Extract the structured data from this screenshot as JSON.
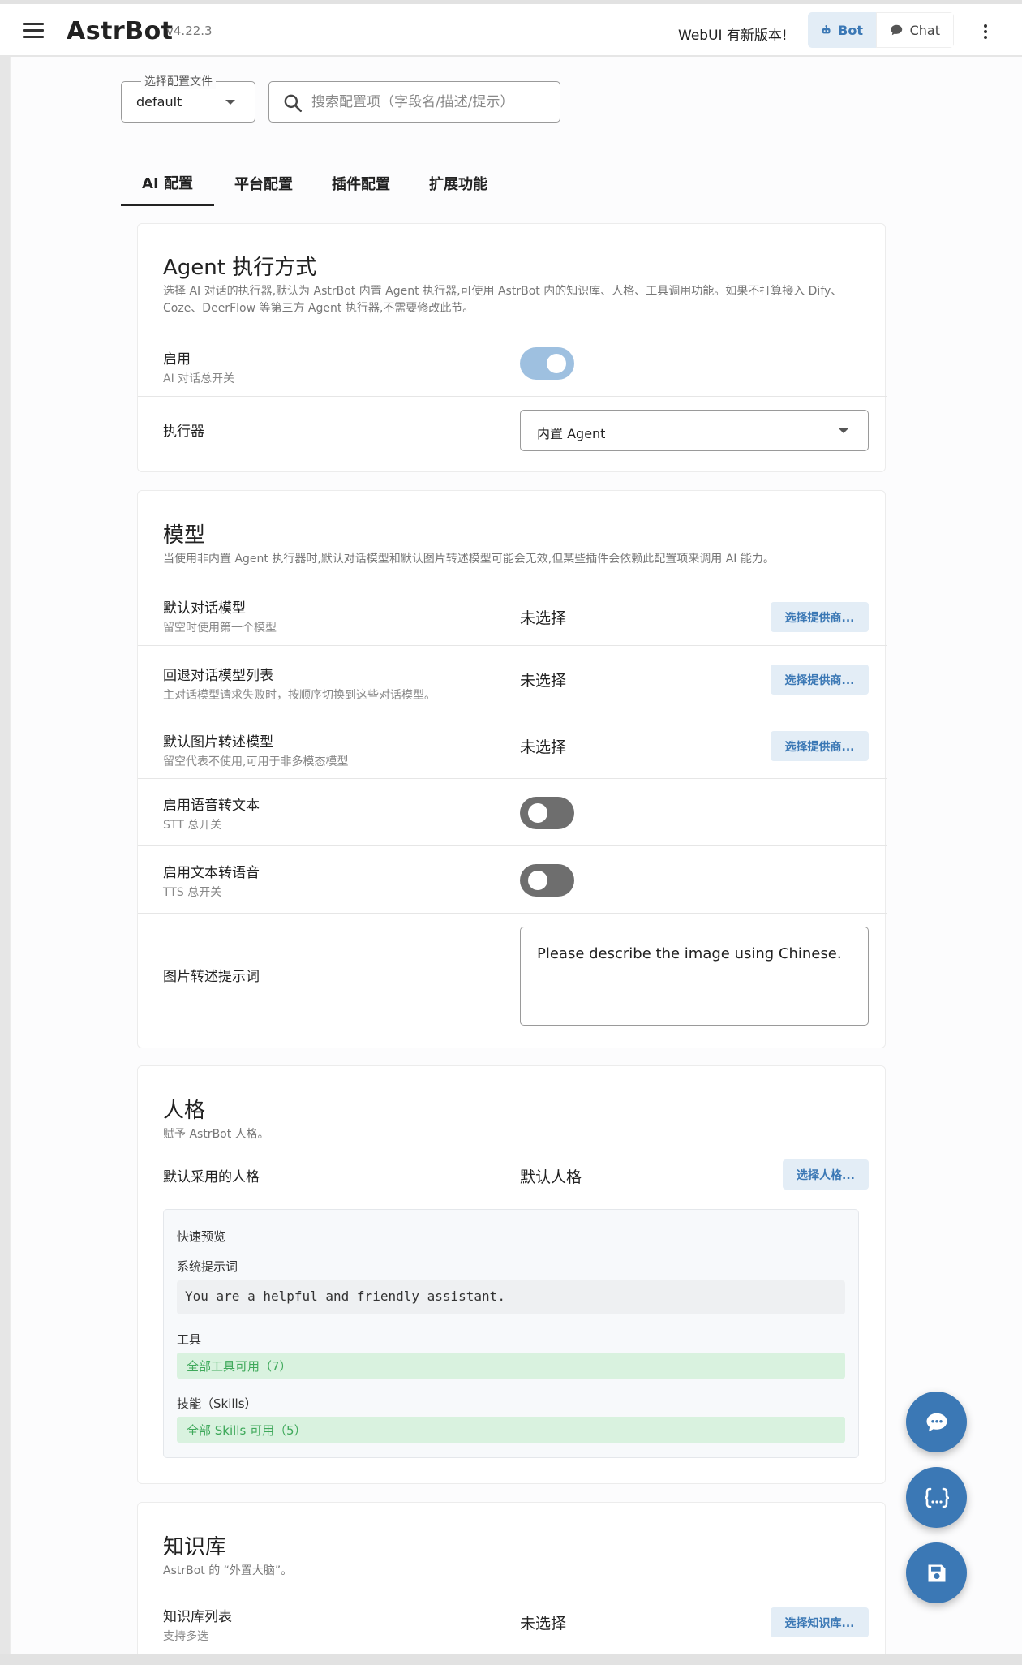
{
  "app": {
    "name": "AstrBot",
    "version": "v4.22.3",
    "update_notice": "WebUI 有新版本!",
    "bot_label": "Bot",
    "chat_label": "Chat"
  },
  "config_file": {
    "legend": "选择配置文件",
    "value": "default"
  },
  "search": {
    "placeholder": "搜索配置项（字段名/描述/提示）"
  },
  "tabs": [
    {
      "label": "AI 配置",
      "active": true
    },
    {
      "label": "平台配置",
      "active": false
    },
    {
      "label": "插件配置",
      "active": false
    },
    {
      "label": "扩展功能",
      "active": false
    }
  ],
  "agent_section": {
    "title": "Agent 执行方式",
    "description": "选择 AI 对话的执行器,默认为 AstrBot 内置 Agent 执行器,可使用 AstrBot 内的知识库、人格、工具调用功能。如果不打算接入 Dify、Coze、DeerFlow 等第三方 Agent 执行器,不需要修改此节。",
    "enable_label": "启用",
    "enable_sub": "AI 对话总开关",
    "enable_on": true,
    "executor_label": "执行器",
    "executor_value": "内置 Agent"
  },
  "model_section": {
    "title": "模型",
    "description": "当使用非内置 Agent 执行器时,默认对话模型和默认图片转述模型可能会无效,但某些插件会依赖此配置项来调用 AI 能力。",
    "rows": [
      {
        "label": "默认对话模型",
        "sub": "留空时使用第一个模型",
        "value": "未选择",
        "button": "选择提供商..."
      },
      {
        "label": "回退对话模型列表",
        "sub": "主对话模型请求失败时，按顺序切换到这些对话模型。",
        "value": "未选择",
        "button": "选择提供商..."
      },
      {
        "label": "默认图片转述模型",
        "sub": "留空代表不使用,可用于非多模态模型",
        "value": "未选择",
        "button": "选择提供商..."
      }
    ],
    "stt_label": "启用语音转文本",
    "stt_sub": "STT 总开关",
    "stt_on": false,
    "tts_label": "启用文本转语音",
    "tts_sub": "TTS 总开关",
    "tts_on": false,
    "caption_prompt_label": "图片转述提示词",
    "caption_prompt_value": "Please describe the image using Chinese."
  },
  "persona_section": {
    "title": "人格",
    "description": "赋予 AstrBot 人格。",
    "default_label": "默认采用的人格",
    "default_value": "默认人格",
    "button": "选择人格...",
    "preview": {
      "title": "快速预览",
      "system_prompt_label": "系统提示词",
      "system_prompt": "You are a helpful and friendly assistant.",
      "tools_label": "工具",
      "tools_value": "全部工具可用（7）",
      "skills_label": "技能（Skills）",
      "skills_value": "全部 Skills 可用（5）"
    }
  },
  "kb_section": {
    "title": "知识库",
    "description": "AstrBot 的 “外置大脑”。",
    "list_label": "知识库列表",
    "list_sub": "支持多选",
    "list_value": "未选择",
    "button": "选择知识库..."
  },
  "colors": {
    "primary": "#3b78b5",
    "chip_bg": "#e3edf6",
    "toggle_on": "#9ec0e0",
    "toggle_off": "#6e6e6e",
    "success_bg": "#d9f2df",
    "success_text": "#3fa95b"
  },
  "icons": [
    "menu-icon",
    "robot-icon",
    "chat-bubble-icon",
    "more-vert-icon",
    "search-icon",
    "dropdown-caret-icon",
    "chat-fab-icon",
    "json-braces-icon",
    "save-icon"
  ]
}
